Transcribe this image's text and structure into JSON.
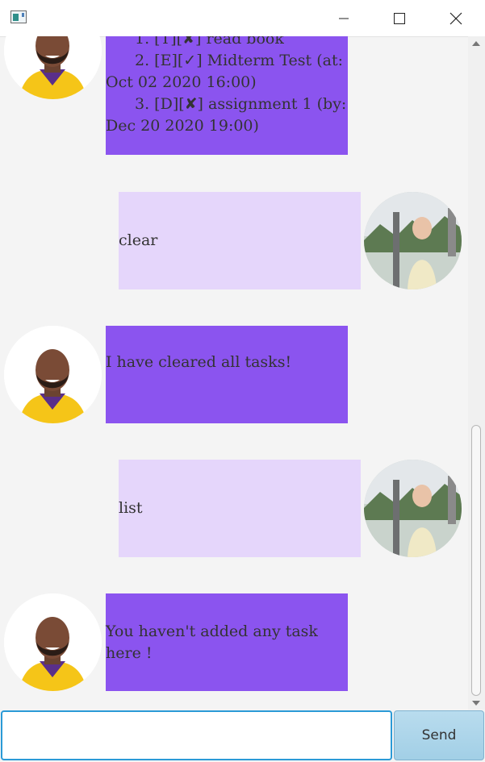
{
  "window": {
    "controls": [
      "minimize-icon",
      "maximize-icon",
      "close-icon"
    ]
  },
  "messages": [
    {
      "sender": "duke",
      "lines": [
        "1. [T][✘] read book",
        "2. [E][✓] Midterm Test (at:",
        "Oct 02 2020 16:00)",
        "3. [D][✘] assignment 1 (by:",
        "Dec 20 2020 19:00)"
      ]
    },
    {
      "sender": "user",
      "text": "clear"
    },
    {
      "sender": "duke",
      "text": "I have cleared all tasks!"
    },
    {
      "sender": "user",
      "text": "list"
    },
    {
      "sender": "duke",
      "text": "You haven't added any task here !"
    }
  ],
  "input": {
    "value": "",
    "placeholder": ""
  },
  "send_label": "Send",
  "colors": {
    "duke_bubble": "#8b54ef",
    "user_bubble": "#e5d6fb",
    "input_border": "#2b9ad6",
    "send_button": "#a8d3e9"
  }
}
